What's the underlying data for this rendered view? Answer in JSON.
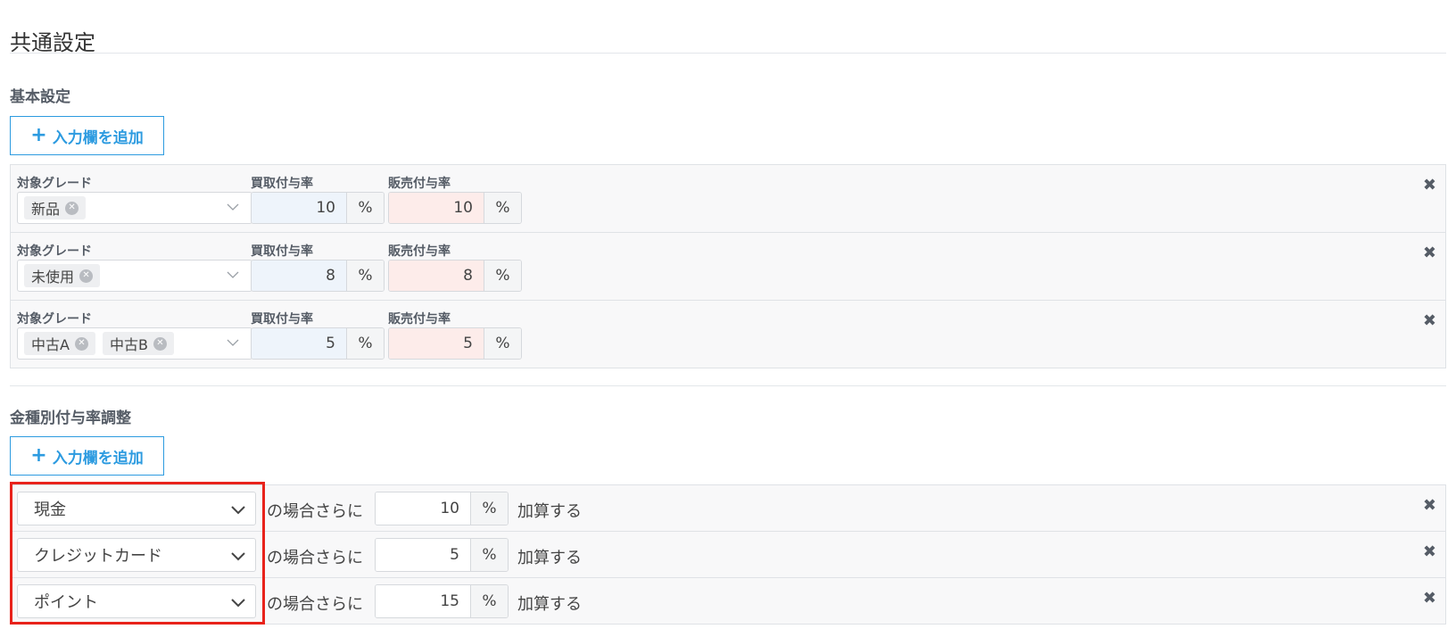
{
  "page": {
    "title": "共通設定"
  },
  "basic": {
    "heading": "基本設定",
    "add_label": "入力欄を追加",
    "rows": [
      {
        "grade_label": "対象グレード",
        "tags": [
          "新品"
        ],
        "buy_label": "買取付与率",
        "buy_value": "10",
        "buy_unit": "%",
        "sell_label": "販売付与率",
        "sell_value": "10",
        "sell_unit": "%"
      },
      {
        "grade_label": "対象グレード",
        "tags": [
          "未使用"
        ],
        "buy_label": "買取付与率",
        "buy_value": "8",
        "buy_unit": "%",
        "sell_label": "販売付与率",
        "sell_value": "8",
        "sell_unit": "%"
      },
      {
        "grade_label": "対象グレード",
        "tags": [
          "中古A",
          "中古B"
        ],
        "buy_label": "買取付与率",
        "buy_value": "5",
        "buy_unit": "%",
        "sell_label": "販売付与率",
        "sell_value": "5",
        "sell_unit": "%"
      }
    ]
  },
  "adjust": {
    "heading": "金種別付与率調整",
    "add_label": "入力欄を追加",
    "rows": [
      {
        "method": "現金",
        "condition": "の場合さらに",
        "value": "10",
        "unit": "%",
        "suffix": "加算する"
      },
      {
        "method": "クレジットカード",
        "condition": "の場合さらに",
        "value": "5",
        "unit": "%",
        "suffix": "加算する"
      },
      {
        "method": "ポイント",
        "condition": "の場合さらに",
        "value": "15",
        "unit": "%",
        "suffix": "加算する"
      }
    ]
  },
  "icons": {
    "plus": "plus-icon",
    "remove": "close-icon",
    "tag_remove": "circle-x-icon",
    "dropdown": "chevron-down-icon"
  },
  "colors": {
    "accent": "#2d9be0",
    "highlight": "#e8221b",
    "buy_bg": "#eef4fb",
    "sell_bg": "#fdecea"
  }
}
